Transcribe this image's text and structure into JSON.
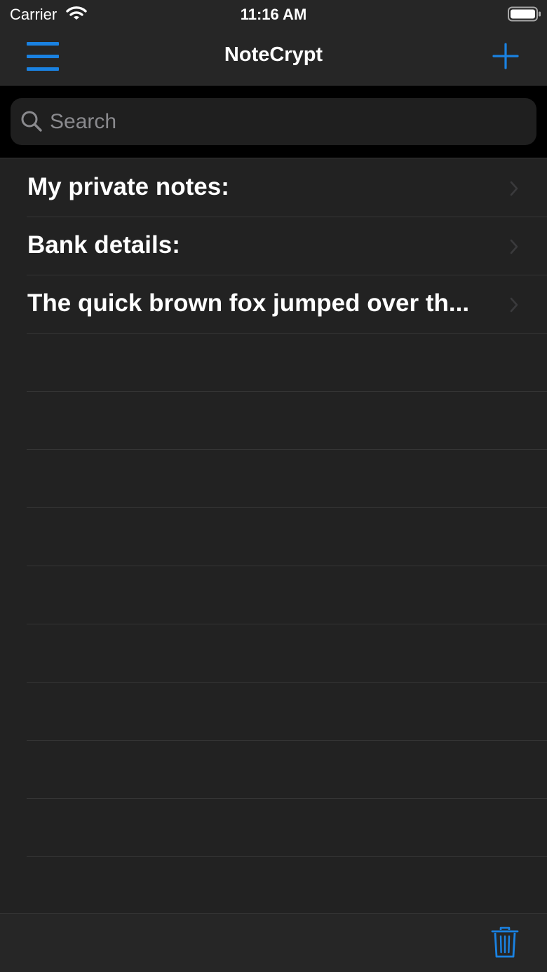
{
  "status_bar": {
    "carrier": "Carrier",
    "time": "11:16 AM"
  },
  "nav_bar": {
    "title": "NoteCrypt",
    "menu_icon": "hamburger-menu-icon",
    "add_icon": "plus-icon"
  },
  "search": {
    "placeholder": "Search",
    "value": ""
  },
  "notes": [
    {
      "title": "My private notes:"
    },
    {
      "title": "Bank details:"
    },
    {
      "title": "The quick brown fox jumped over th..."
    }
  ],
  "toolbar": {
    "trash_icon": "trash-icon"
  },
  "colors": {
    "accent": "#1a82e2",
    "background": "#222222",
    "bar_background": "#262626",
    "search_background": "#000000",
    "separator": "#353535"
  }
}
